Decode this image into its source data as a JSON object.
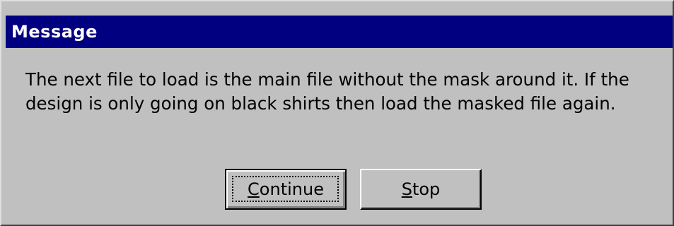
{
  "window": {
    "title": "Message"
  },
  "message": {
    "text": "The next file to load is the main file without the mask around it.  If the design is only going on black shirts then load the masked file again."
  },
  "buttons": {
    "continue_label": "Continue",
    "stop_label": "Stop"
  },
  "colors": {
    "titlebar": "#000080",
    "face": "#c0c0c0",
    "title_text": "#ffffff"
  }
}
